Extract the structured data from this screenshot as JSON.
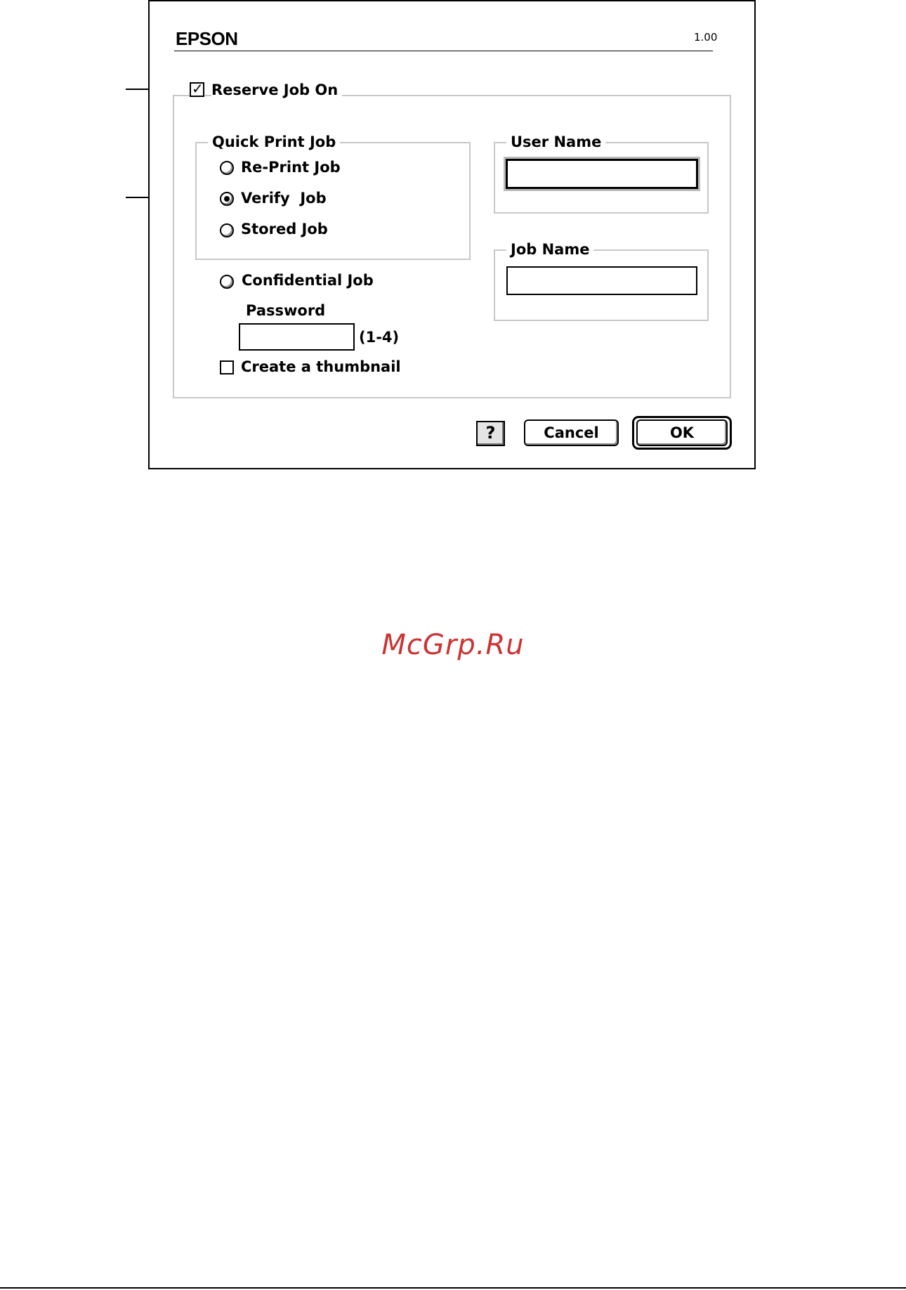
{
  "dialog": {
    "brand": "EPSON",
    "version": "1.00"
  },
  "reserve_job": {
    "label": "Reserve Job On",
    "checked": true
  },
  "quick_print": {
    "legend": "Quick Print Job",
    "options": [
      {
        "label": "Re-Print Job",
        "selected": false
      },
      {
        "label": "Verify  Job",
        "selected": true
      },
      {
        "label": "Stored Job",
        "selected": false
      }
    ]
  },
  "confidential": {
    "label": "Confidential Job",
    "selected": false,
    "password_label": "Password",
    "password_value": "",
    "password_hint": "(1-4)"
  },
  "thumbnail": {
    "label": "Create a thumbnail",
    "checked": false
  },
  "user_name": {
    "legend": "User Name",
    "value": ""
  },
  "job_name": {
    "legend": "Job Name",
    "value": ""
  },
  "buttons": {
    "help": "?",
    "cancel": "Cancel",
    "ok": "OK"
  },
  "watermark": "McGrp.Ru"
}
